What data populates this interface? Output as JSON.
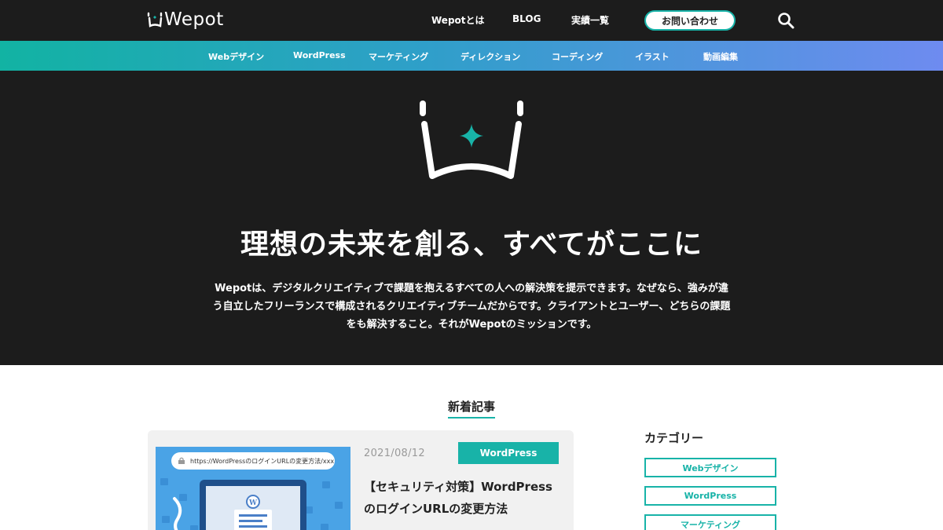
{
  "header": {
    "logo_text": "Wepot",
    "nav": [
      {
        "label": "Wepotとは"
      },
      {
        "label": "BLOG"
      },
      {
        "label": "実績一覧"
      }
    ],
    "contact_label": "お問い合わせ"
  },
  "categories_bar": [
    {
      "label": "Webデザイン"
    },
    {
      "label": "WordPress"
    },
    {
      "label": "マーケティング"
    },
    {
      "label": "ディレクション"
    },
    {
      "label": "コーディング"
    },
    {
      "label": "イラスト"
    },
    {
      "label": "動画編集"
    }
  ],
  "hero": {
    "title": "理想の未来を創る、すべてがここに",
    "description": "Wepotは、デジタルクリエイティブで課題を抱えるすべての人への解決策を提示できます。なぜなら、強みが違う自立したフリーランスで構成されるクリエイティブチームだからです。クライアントとユーザー、どちらの課題をも解決すること。それがWepotのミッションです。"
  },
  "latest": {
    "heading": "新着記事",
    "article": {
      "thumb_url": "https://WordPressのログインURLの変更方法/xxx",
      "date": "2021/08/12",
      "category": "WordPress",
      "title": "【セキュリティ対策】WordPressのログインURLの変更方法"
    }
  },
  "sidebar": {
    "title": "カテゴリー",
    "items": [
      {
        "label": "Webデザイン"
      },
      {
        "label": "WordPress"
      },
      {
        "label": "マーケティング"
      }
    ]
  },
  "colors": {
    "accent": "#18b3a8",
    "dark_bg": "#1c1c1c",
    "gradient_end": "#6e8bf0"
  }
}
